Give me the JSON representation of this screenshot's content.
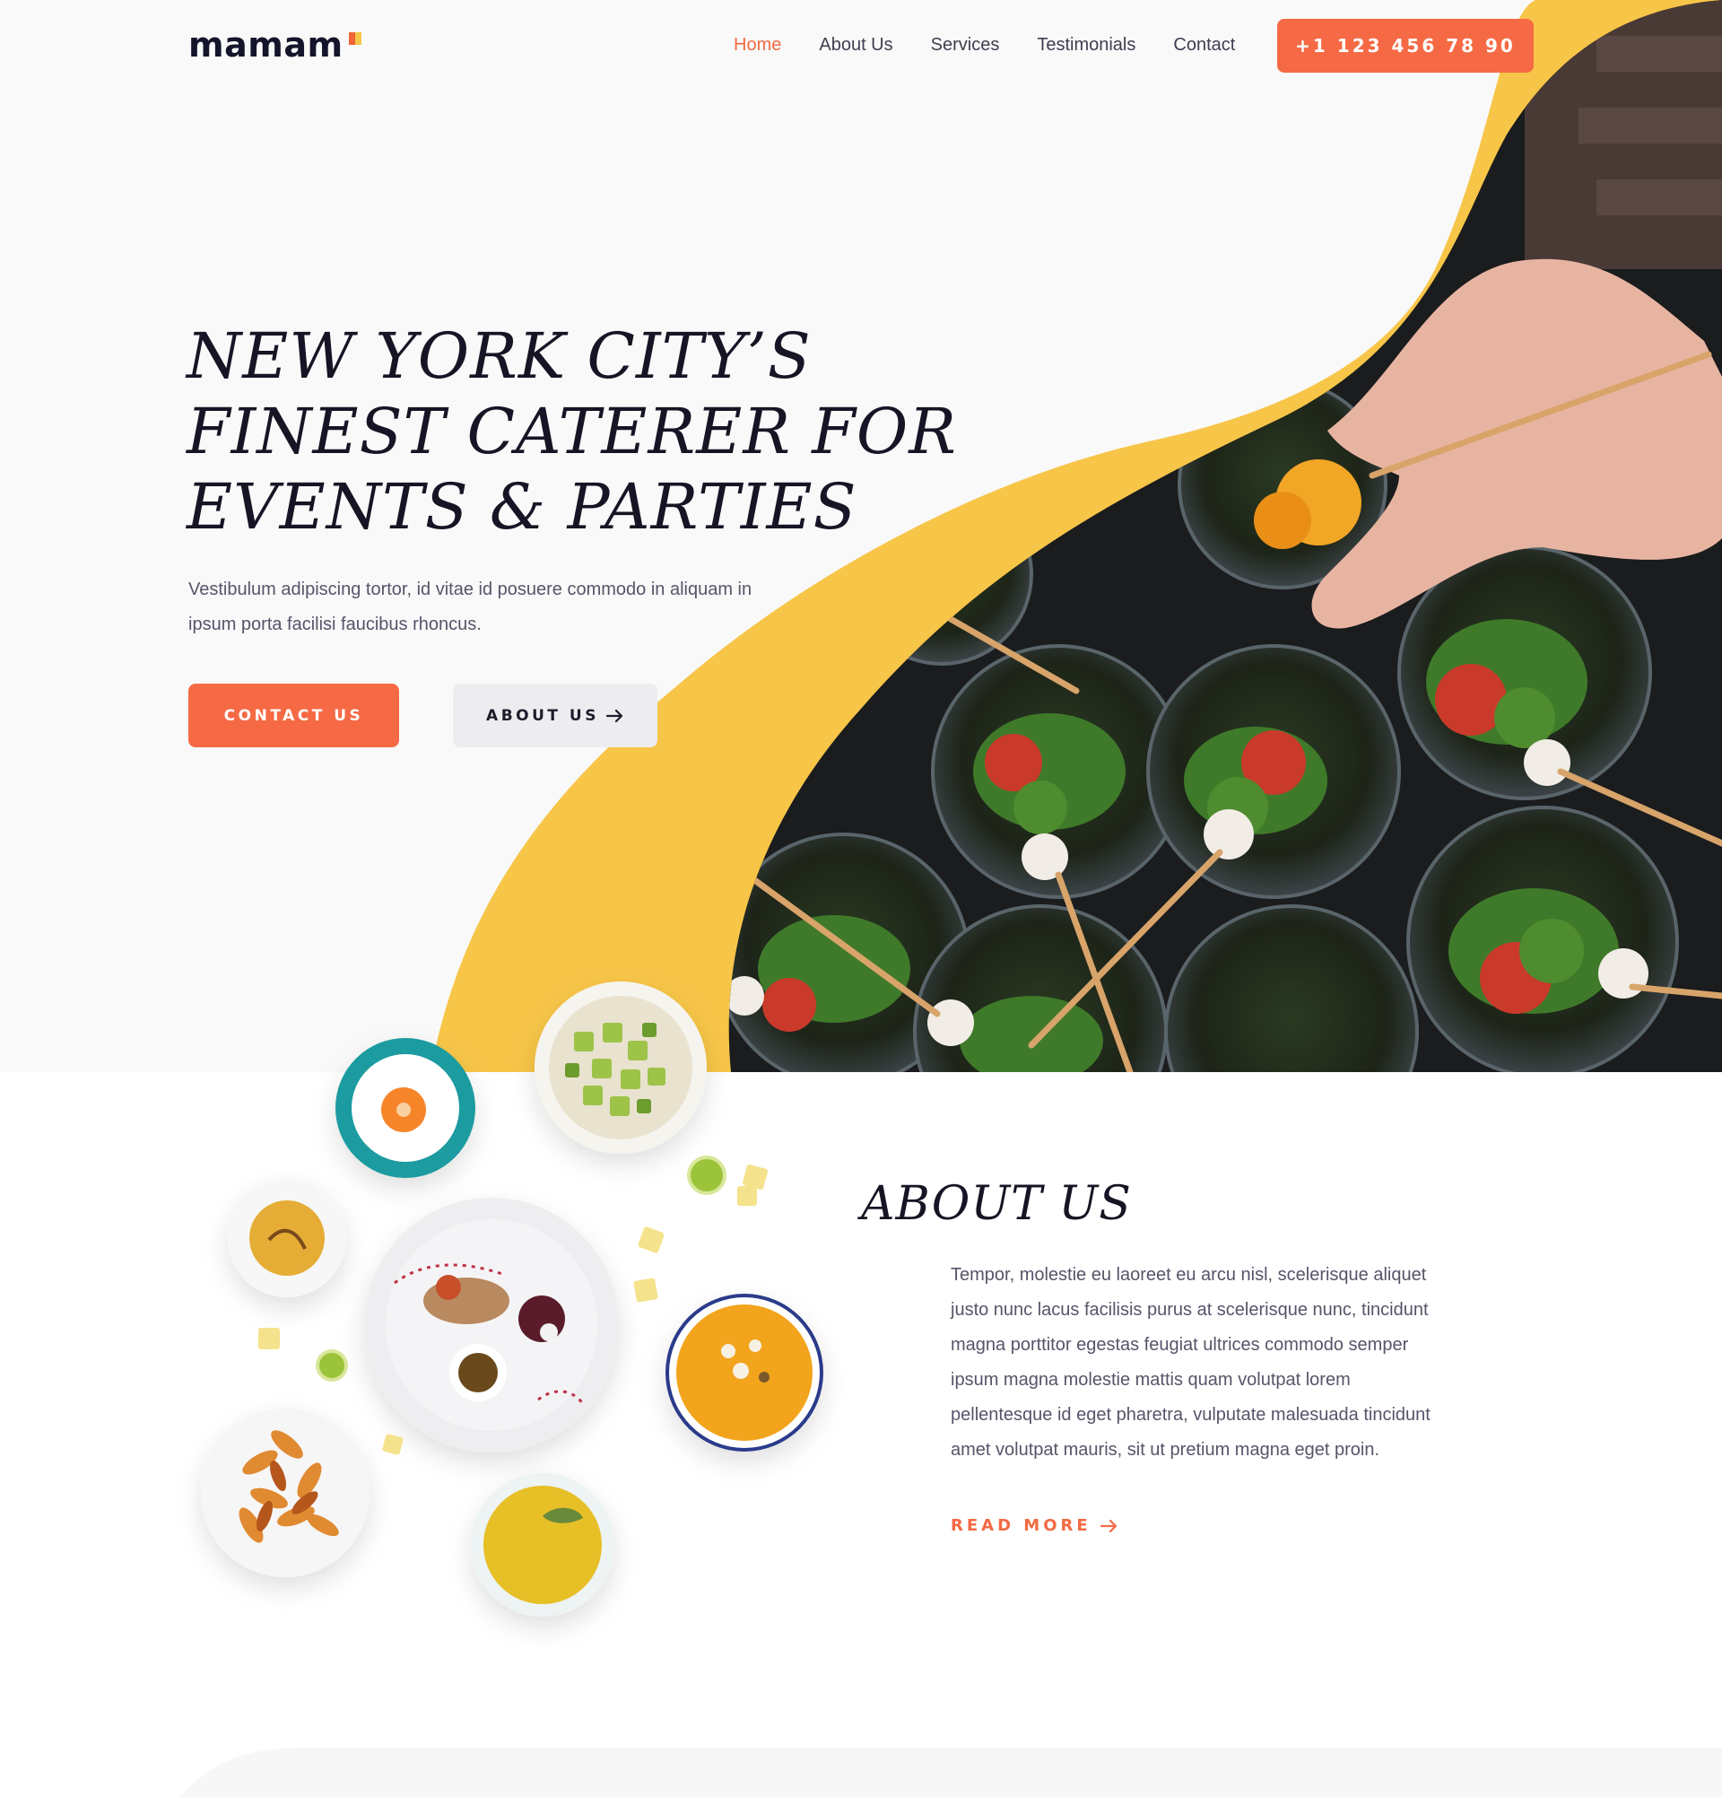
{
  "brand": {
    "name": "mamam"
  },
  "nav": {
    "items": [
      "Home",
      "About Us",
      "Services",
      "Testimonials",
      "Contact"
    ],
    "active": "Home",
    "phone": "+1 123 456 78 90"
  },
  "hero": {
    "title_lines": [
      "NEW YORK CITY’S",
      "FINEST CATERER FOR",
      "EVENTS & PARTIES"
    ],
    "text": "Vestibulum adipiscing tortor, id vitae id posuere commodo in aliquam in ipsum porta facilisi faucibus rhoncus.",
    "cta_primary": "CONTACT US",
    "cta_secondary": "ABOUT US",
    "image_alt": "appetizer-cups-photo"
  },
  "about": {
    "title": "ABOUT US",
    "text": "Tempor, molestie eu laoreet eu arcu nisl, scelerisque aliquet justo nunc lacus facilisis purus at scelerisque nunc, tincidunt magna porttitor egestas feugiat ultrices commodo semper ipsum magna molestie mattis quam volutpat lorem pellentesque id eget pharetra, vulputate malesuada tincidunt amet volutpat mauris, sit ut pretium magna eget proin.",
    "read_more": "READ MORE"
  },
  "colors": {
    "accent": "#f56a45",
    "yellow": "#f7c548",
    "dark": "#151525",
    "text": "#55556a",
    "hero_bg": "#f9f9f9"
  },
  "icons": [
    "arrow-right-icon",
    "logo-mark-icon"
  ]
}
